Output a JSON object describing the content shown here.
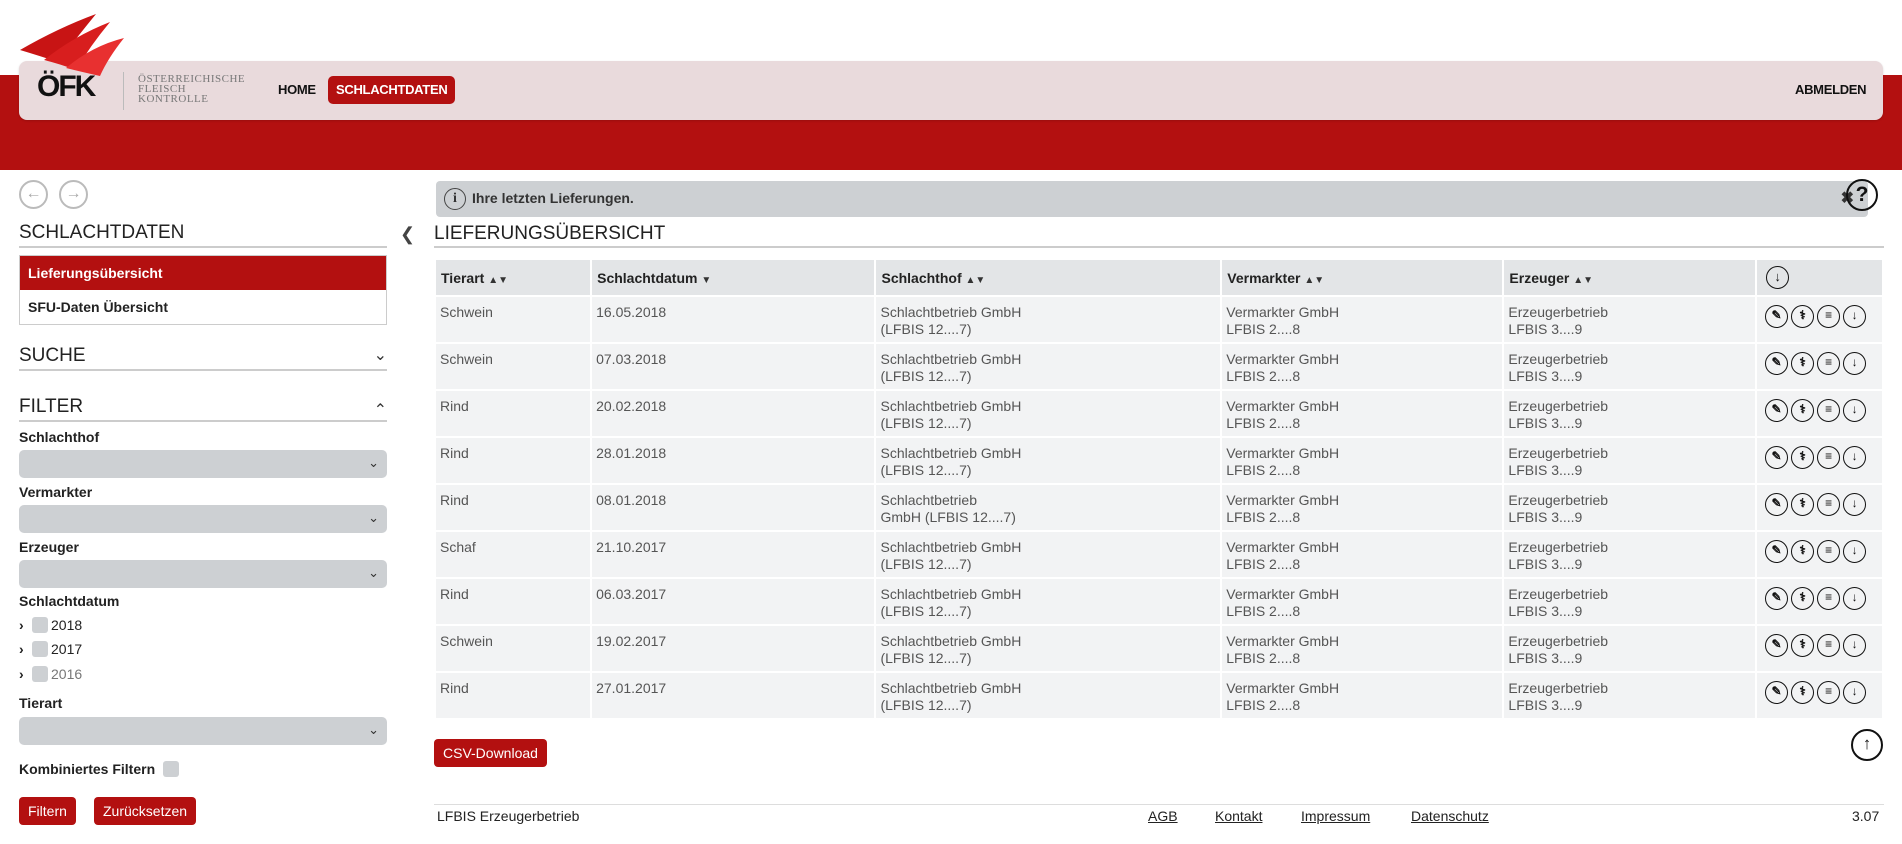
{
  "brand": {
    "logo_text": "ÖFK",
    "logo_sub_1": "Österreichische",
    "logo_sub_2": "Fleisch",
    "logo_sub_3": "Kontrolle"
  },
  "nav": {
    "home": "HOME",
    "schlachtdaten": "SCHLACHTDATEN",
    "abmelden": "ABMELDEN"
  },
  "sidebar": {
    "title": "SCHLACHTDATEN",
    "menu": [
      {
        "label": "Lieferungsübersicht",
        "active": true
      },
      {
        "label": "SFU-Daten Übersicht",
        "active": false
      }
    ],
    "suche": "SUCHE",
    "filter": "FILTER",
    "labels": {
      "schlachthof": "Schlachthof",
      "vermarkter": "Vermarkter",
      "erzeuger": "Erzeuger",
      "schlachtdatum": "Schlachtdatum",
      "tierart": "Tierart",
      "kombiniert": "Kombiniertes Filtern"
    },
    "years": [
      "2018",
      "2017",
      "2016"
    ],
    "filtern_button": "Filtern",
    "reset_button": "Zurücksetzen"
  },
  "info": {
    "message": "Ihre letzten Lieferungen."
  },
  "main": {
    "title": "LIEFERUNGSÜBERSICHT",
    "columns": [
      "Tierart",
      "Schlachtdatum",
      "Schlachthof",
      "Vermarkter",
      "Erzeuger"
    ],
    "rows": [
      {
        "tierart": "Schwein",
        "datum": "16.05.2018",
        "schlachthof": [
          "Schlachtbetrieb GmbH",
          "(LFBIS 12....7)"
        ],
        "vermarkter": [
          "Vermarkter GmbH",
          "LFBIS 2....8"
        ],
        "erzeuger": [
          "Erzeugerbetrieb",
          "LFBIS 3....9"
        ]
      },
      {
        "tierart": "Schwein",
        "datum": "07.03.2018",
        "schlachthof": [
          "Schlachtbetrieb GmbH",
          "(LFBIS 12....7)"
        ],
        "vermarkter": [
          "Vermarkter GmbH",
          "LFBIS 2....8"
        ],
        "erzeuger": [
          "Erzeugerbetrieb",
          "LFBIS 3....9"
        ]
      },
      {
        "tierart": "Rind",
        "datum": "20.02.2018",
        "schlachthof": [
          "Schlachtbetrieb GmbH",
          "(LFBIS 12....7)"
        ],
        "vermarkter": [
          "Vermarkter GmbH",
          "LFBIS 2....8"
        ],
        "erzeuger": [
          "Erzeugerbetrieb",
          "LFBIS 3....9"
        ]
      },
      {
        "tierart": "Rind",
        "datum": "28.01.2018",
        "schlachthof": [
          "Schlachtbetrieb GmbH",
          "(LFBIS 12....7)"
        ],
        "vermarkter": [
          "Vermarkter GmbH",
          "LFBIS 2....8"
        ],
        "erzeuger": [
          "Erzeugerbetrieb",
          "LFBIS 3....9"
        ]
      },
      {
        "tierart": "Rind",
        "datum": "08.01.2018",
        "schlachthof": [
          "Schlachtbetrieb",
          "GmbH (LFBIS 12....7)"
        ],
        "vermarkter": [
          "Vermarkter GmbH",
          "LFBIS 2....8"
        ],
        "erzeuger": [
          "Erzeugerbetrieb",
          "LFBIS 3....9"
        ]
      },
      {
        "tierart": "Schaf",
        "datum": "21.10.2017",
        "schlachthof": [
          "Schlachtbetrieb GmbH",
          "(LFBIS 12....7)"
        ],
        "vermarkter": [
          "Vermarkter GmbH",
          "LFBIS 2....8"
        ],
        "erzeuger": [
          "Erzeugerbetrieb",
          "LFBIS 3....9"
        ]
      },
      {
        "tierart": "Rind",
        "datum": "06.03.2017",
        "schlachthof": [
          "Schlachtbetrieb GmbH",
          "(LFBIS 12....7)"
        ],
        "vermarkter": [
          "Vermarkter GmbH",
          "LFBIS 2....8"
        ],
        "erzeuger": [
          "Erzeugerbetrieb",
          "LFBIS 3....9"
        ]
      },
      {
        "tierart": "Schwein",
        "datum": "19.02.2017",
        "schlachthof": [
          "Schlachtbetrieb GmbH",
          "(LFBIS 12....7)"
        ],
        "vermarkter": [
          "Vermarkter GmbH",
          "LFBIS 2....8"
        ],
        "erzeuger": [
          "Erzeugerbetrieb",
          "LFBIS 3....9"
        ]
      },
      {
        "tierart": "Rind",
        "datum": "27.01.2017",
        "schlachthof": [
          "Schlachtbetrieb GmbH",
          "(LFBIS 12....7)"
        ],
        "vermarkter": [
          "Vermarkter GmbH",
          "LFBIS 2....8"
        ],
        "erzeuger": [
          "Erzeugerbetrieb",
          "LFBIS 3....9"
        ]
      }
    ],
    "row_action_icons": [
      "syringe-icon",
      "stethoscope-icon",
      "list-icon",
      "download-icon"
    ],
    "csv_button": "CSV-Download"
  },
  "footer": {
    "left": "LFBIS Erzeugerbetrieb",
    "links": [
      "AGB",
      "Kontakt",
      "Impressum",
      "Datenschutz"
    ],
    "version": "3.07"
  },
  "colors": {
    "brand_red": "#b31010",
    "nav_bg": "#e9dadc",
    "control_gray": "#cdd0d3"
  }
}
